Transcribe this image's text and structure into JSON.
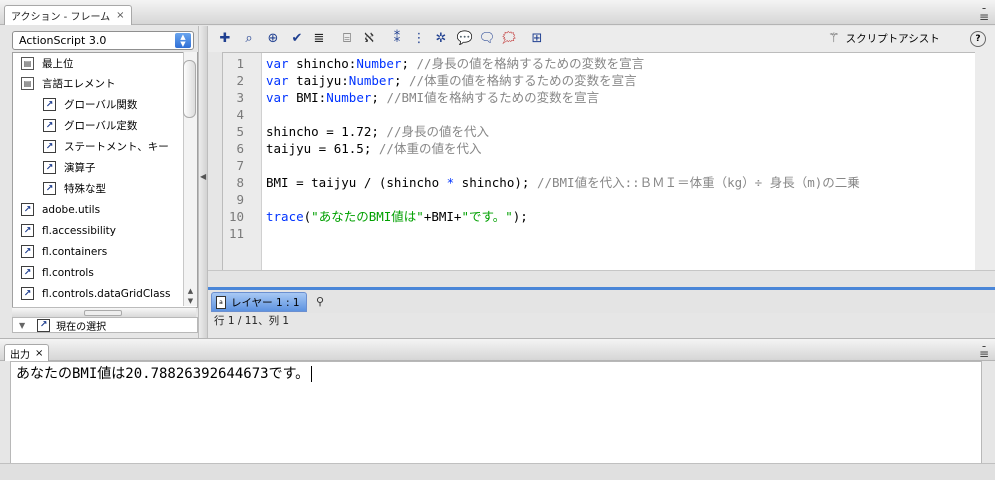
{
  "actions_panel": {
    "tab_title": "アクション - フレーム",
    "close_glyph": "×",
    "menu_glyph": "≡",
    "language_select": {
      "value": "ActionScript 3.0",
      "arrows": "▲▼"
    },
    "toolbox_items": [
      {
        "label": "最上位",
        "icon": "book-icon"
      },
      {
        "label": "言語エレメント",
        "icon": "book-icon"
      },
      {
        "label": "グローバル関数",
        "icon": "arrow-box-icon"
      },
      {
        "label": "グローバル定数",
        "icon": "arrow-box-icon"
      },
      {
        "label": "ステートメント、キー",
        "icon": "arrow-box-icon"
      },
      {
        "label": "演算子",
        "icon": "arrow-box-icon"
      },
      {
        "label": "特殊な型",
        "icon": "arrow-box-icon"
      },
      {
        "label": "adobe.utils",
        "icon": "arrow-box-icon"
      },
      {
        "label": "fl.accessibility",
        "icon": "arrow-box-icon"
      },
      {
        "label": "fl.containers",
        "icon": "arrow-box-icon"
      },
      {
        "label": "fl.controls",
        "icon": "arrow-box-icon"
      },
      {
        "label": "fl.controls.dataGridClass",
        "icon": "arrow-box-icon"
      }
    ],
    "current_selection_label": "現在の選択",
    "assist_label": "スクリプトアシスト",
    "help_glyph": "?",
    "toolbar_icons": [
      "add-statement-icon",
      "find-icon",
      "target-path-icon",
      "check-syntax-icon",
      "auto-format-icon",
      "code-hint-icon",
      "debug-options-icon",
      "collapse-braces-icon",
      "collapse-selection-icon",
      "expand-all-icon",
      "apply-block-comment-icon",
      "apply-line-comment-icon",
      "remove-comment-icon",
      "show-toolbox-icon"
    ],
    "line_numbers": [
      "1",
      "2",
      "3",
      "4",
      "5",
      "6",
      "7",
      "8",
      "9",
      "10",
      "11"
    ],
    "code": {
      "l1_kw": "var",
      "l1_a": " shincho:",
      "l1_ty": "Number",
      "l1_b": "; ",
      "l1_cm": "//身長の値を格納するための変数を宣言",
      "l2_kw": "var",
      "l2_a": " taijyu:",
      "l2_ty": "Number",
      "l2_b": "; ",
      "l2_cm": "//体重の値を格納するための変数を宣言",
      "l3_kw": "var",
      "l3_a": " BMI:",
      "l3_ty": "Number",
      "l3_b": "; ",
      "l3_cm": "//BMI値を格納するための変数を宣言",
      "l5_a": "shincho = 1.72; ",
      "l5_cm": "//身長の値を代入",
      "l6_a": "taijyu = 61.5; ",
      "l6_cm": "//体重の値を代入",
      "l8_a": "BMI = taijyu / (shincho ",
      "l8_op": "*",
      "l8_b": " shincho); ",
      "l8_cm": "//BMI値を代入::ＢＭＩ＝体重（kg）÷ 身長（m)の二乗",
      "l10_fn": "trace",
      "l10_a": "(",
      "l10_s1": "\"あなたのBMI値は\"",
      "l10_b": "+BMI+",
      "l10_s2": "\"です。\"",
      "l10_c": ");"
    },
    "layer_tab": "レイヤー 1 : 1",
    "cursor_status": "行 1 / 11、列 1"
  },
  "output_panel": {
    "tab_title": "出力",
    "close_glyph": "×",
    "menu_glyph": "≡",
    "text": "あなたのBMI値は20.78826392644673です。"
  }
}
